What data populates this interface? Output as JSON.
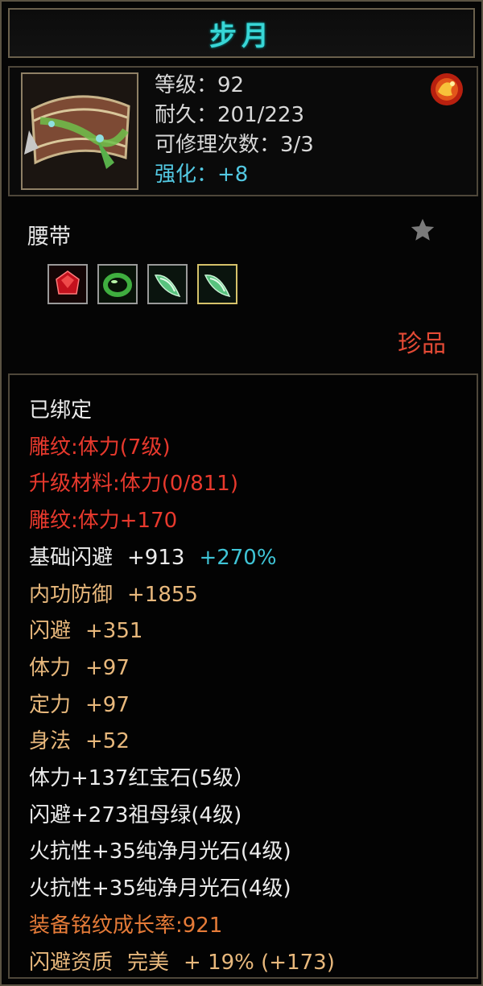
{
  "tooltip": {
    "title": "步月",
    "stats": {
      "level": "等级：92",
      "durability": "耐久：201/223",
      "repairs": "可修理次数：3/3",
      "enhance": "强化：+8"
    },
    "item_type": "腰带",
    "quality": "珍品",
    "gems": [
      "ruby-icon",
      "emerald-ring-icon",
      "moonstone-icon",
      "moonstone-icon"
    ]
  },
  "attributes": {
    "bound": "已绑定",
    "engrave": "雕纹:体力(7级)",
    "upgrade_material": "升级材料:体力(0/811)",
    "engrave_bonus": "雕纹:体力+170",
    "base_dodge_label": "基础闪避",
    "base_dodge_value": "+913",
    "base_dodge_pct": "+270%",
    "inner_def_label": "内功防御",
    "inner_def_value": "+1855",
    "dodge_label": "闪避",
    "dodge_value": "+351",
    "stamina_label": "体力",
    "stamina_value": "+97",
    "focus_label": "定力",
    "focus_value": "+97",
    "agility_label": "身法",
    "agility_value": "+52",
    "gem1": "体力+137红宝石(5级）",
    "gem2": "闪避+273祖母绿(4级)",
    "gem3": "火抗性+35纯净月光石(4级)",
    "gem4": "火抗性+35纯净月光石(4级)",
    "growth": "装备铭纹成长率:921",
    "quality_label": "闪避资质",
    "quality_grade": "完美",
    "quality_bonus": "+ 19% (+173)"
  },
  "colors": {
    "title": "#38d6d6",
    "engrave_red": "#e8392d",
    "attr_gold": "#e8b87c",
    "growth_orange": "#e57b38",
    "quality_red": "#e34a35"
  }
}
